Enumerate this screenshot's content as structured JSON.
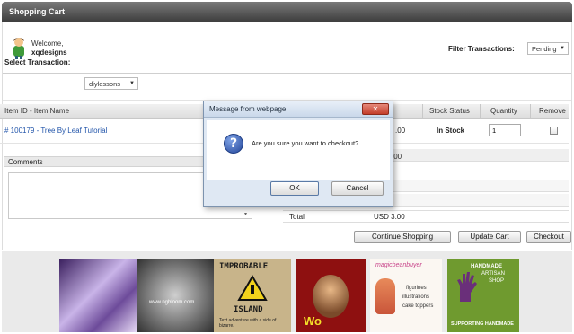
{
  "window": {
    "title": "Shopping Cart"
  },
  "user": {
    "welcome": "Welcome,",
    "name": "xqdesigns"
  },
  "filter": {
    "label": "Filter Transactions:",
    "value": "Pending"
  },
  "select_transaction": {
    "label": "Select Transaction:",
    "value": "diylessons"
  },
  "table": {
    "headers": {
      "item": "Item ID - Item Name",
      "stock": "Stock Status",
      "quantity": "Quantity",
      "remove": "Remove"
    },
    "rows": [
      {
        "item": "# 100179 - Tree By Leaf Tutorial",
        "price_fragment": ".00",
        "stock": "In Stock",
        "quantity": "1"
      }
    ]
  },
  "comments": {
    "label": "Comments"
  },
  "summary": {
    "subtotal_fragment": ".00",
    "total_label": "Total",
    "total_value": "USD 3.00"
  },
  "buttons": {
    "continue": "Continue Shopping",
    "update": "Update Cart",
    "checkout": "Checkout"
  },
  "dialog": {
    "title": "Message from webpage",
    "message": "Are you sure you want to checkout?",
    "ok": "OK",
    "cancel": "Cancel"
  },
  "ads": [
    {
      "name": "ad-purple-abstract"
    },
    {
      "name": "ad-silver-swirls",
      "text": "www.ngbloom.com"
    },
    {
      "name": "ad-improbable-island",
      "title": "IMPROBABLE",
      "subtitle": "ISLAND",
      "tagline": "Text adventure with a side of bizarre."
    },
    {
      "name": "ad-bearded-man",
      "text": "Wo"
    },
    {
      "name": "ad-figurines",
      "brand": "magicbeanbuyer",
      "line1": "figurines",
      "line2": "illustrations",
      "line3": "cake toppers"
    },
    {
      "name": "ad-handmade",
      "top": "HANDMADE",
      "mid1": "ARTISAN",
      "mid2": "SHOP",
      "bottom": "SUPPORTING HANDMADE"
    }
  ],
  "colors": {
    "link": "#2255aa",
    "titlebar": "#4a4a4a",
    "dialog_bg": "#dfe8f3",
    "close": "#c33d2a"
  }
}
